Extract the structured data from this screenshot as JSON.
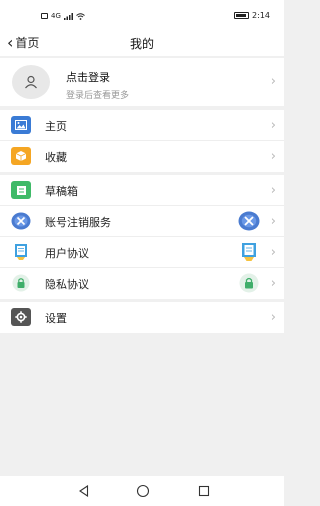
{
  "status_bar": {
    "left_text": "4G",
    "time": "2:14"
  },
  "nav": {
    "back_label": "首页",
    "title": "我的"
  },
  "profile": {
    "title": "点击登录",
    "subtitle": "登录后查看更多"
  },
  "group1": [
    {
      "label": "主页",
      "icon": "image-icon",
      "color": "#3a7bd5"
    },
    {
      "label": "收藏",
      "icon": "box-icon",
      "color": "#f5a623"
    }
  ],
  "group2": [
    {
      "label": "草稿箱",
      "icon": "note-icon",
      "color": "#3fba68"
    },
    {
      "label": "账号注销服务",
      "icon": "close-circle-icon",
      "color": "#4a7bd0"
    },
    {
      "label": "用户协议",
      "icon": "document-icon",
      "color": "#3fa1e0"
    },
    {
      "label": "隐私协议",
      "icon": "lock-icon",
      "color": "#3fae6a"
    }
  ],
  "group3": [
    {
      "label": "设置",
      "icon": "gear-icon",
      "color": "#555555"
    }
  ],
  "colors": {
    "accent_blue": "#3a7bd5",
    "background": "#f0f0f0"
  }
}
